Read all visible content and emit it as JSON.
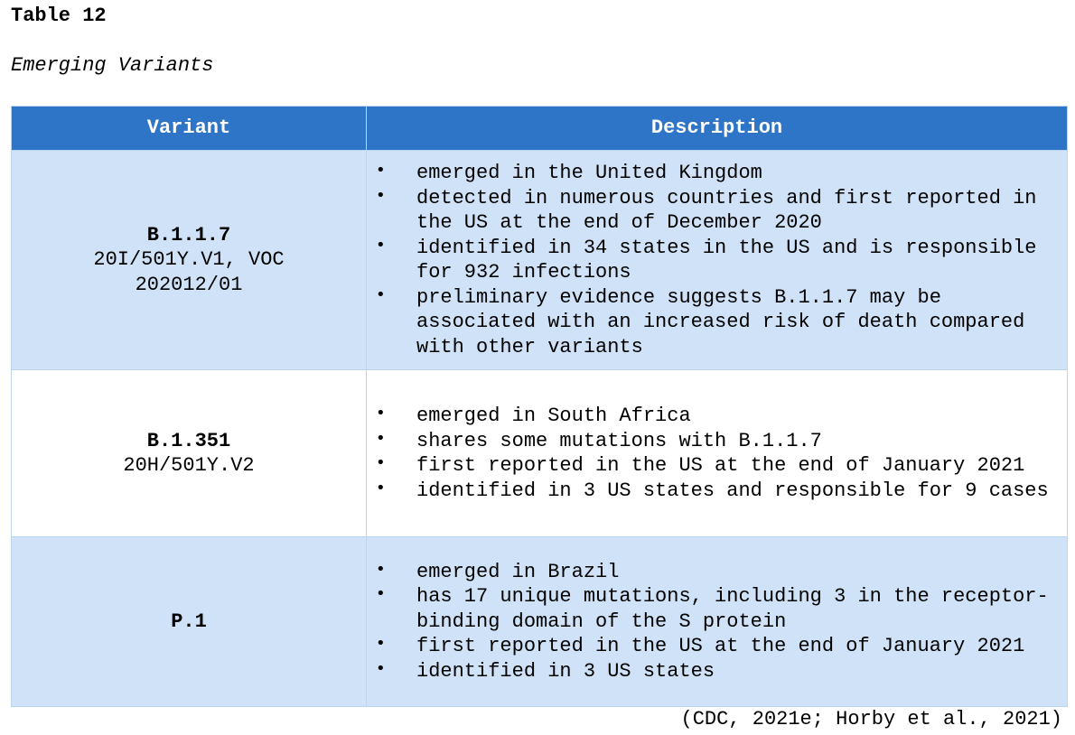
{
  "table_number": "Table 12",
  "table_title": "Emerging Variants",
  "headers": {
    "variant": "Variant",
    "description": "Description"
  },
  "rows": [
    {
      "name": "B.1.1.7",
      "alias": "20I/501Y.V1, VOC 202012/01",
      "bullets": [
        "emerged in the United Kingdom",
        "detected in numerous countries and first reported in the US at the end of December 2020",
        "identified in 34 states in the US and is responsible for 932 infections",
        "preliminary evidence suggests B.1.1.7 may be associated with an increased risk of death compared with other variants"
      ]
    },
    {
      "name": "B.1.351",
      "alias": "20H/501Y.V2",
      "bullets": [
        "emerged in South Africa",
        "shares some mutations with B.1.1.7",
        "first reported in the US at the end of January 2021",
        "identified in 3 US states and responsible for 9 cases"
      ]
    },
    {
      "name": "P.1",
      "alias": "",
      "bullets": [
        "emerged in Brazil",
        "has 17 unique mutations, including 3 in the receptor-binding domain of the S protein",
        "first reported in the US at the end of January 2021",
        "identified in 3 US states"
      ]
    }
  ],
  "bullet_glyph": "•",
  "citation": "(CDC, 2021e; Horby et al., 2021)",
  "colors": {
    "header_bg": "#2e75c7",
    "shaded_row_bg": "#cfe2f7",
    "border": "#bcd6f0"
  }
}
